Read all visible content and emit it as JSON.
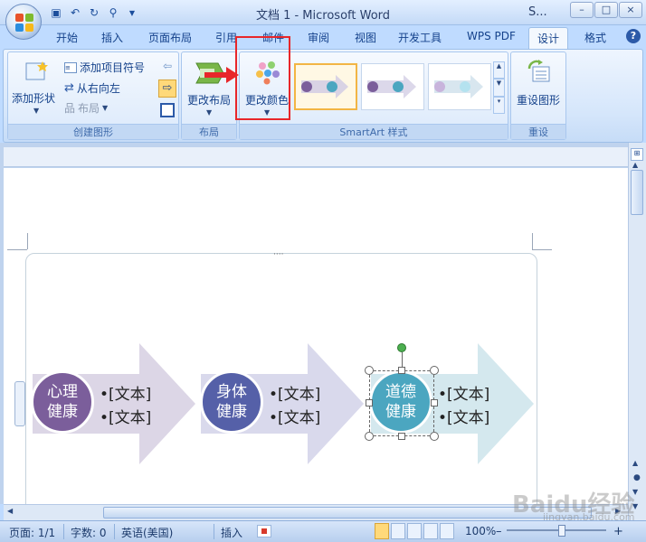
{
  "window": {
    "title": "文档 1 - Microsoft Word",
    "app_abbrev": "S...",
    "controls": [
      "–",
      "□",
      "×"
    ]
  },
  "quick_access": [
    "save-icon",
    "undo-icon",
    "redo-icon",
    "print-preview-icon"
  ],
  "tabs": [
    {
      "label": "开始"
    },
    {
      "label": "插入"
    },
    {
      "label": "页面布局"
    },
    {
      "label": "引用"
    },
    {
      "label": "邮件"
    },
    {
      "label": "审阅"
    },
    {
      "label": "视图"
    },
    {
      "label": "开发工具"
    },
    {
      "label": "WPS PDF"
    },
    {
      "label": "设计",
      "active": true
    },
    {
      "label": "格式"
    }
  ],
  "help_label": "?",
  "ribbon": {
    "create_group": {
      "label": "创建图形",
      "add_shape": "添加形状",
      "add_bullet": "添加项目符号",
      "right_to_left": "从右向左",
      "layout": "布局"
    },
    "layout_group": {
      "label": "布局",
      "change_layout": "更改布局"
    },
    "colors": {
      "label": "更改颜色"
    },
    "styles_group": {
      "label": "SmartArt 样式"
    },
    "reset_group": {
      "label": "重设",
      "reset_graphic": "重设图形"
    }
  },
  "smartart": {
    "nodes": [
      {
        "line1": "心理",
        "line2": "健康",
        "color": "#7b5e9b",
        "arrow_color": "#dcd6e6",
        "bullets": [
          "•[文本]",
          "•[文本]"
        ]
      },
      {
        "line1": "身体",
        "line2": "健康",
        "color": "#5560a8",
        "arrow_color": "#d9d9ec",
        "bullets": [
          "•[文本]",
          "•[文本]"
        ]
      },
      {
        "line1": "道德",
        "line2": "健康",
        "color": "#4ba6c0",
        "arrow_color": "#d4e8ee",
        "bullets": [
          "•[文本]",
          "•[文本]"
        ]
      }
    ]
  },
  "statusbar": {
    "page": "页面: 1/1",
    "words": "字数: 0",
    "language": "英语(美国)",
    "mode": "插入",
    "zoom": "100%",
    "zoom_out": "–",
    "zoom_in": "+"
  },
  "watermark": {
    "brand": "Baidu经验",
    "url": "jingyan.baidu.com"
  },
  "colors": {
    "highlight": "#e8262a",
    "ribbon_text": "#15428b"
  }
}
